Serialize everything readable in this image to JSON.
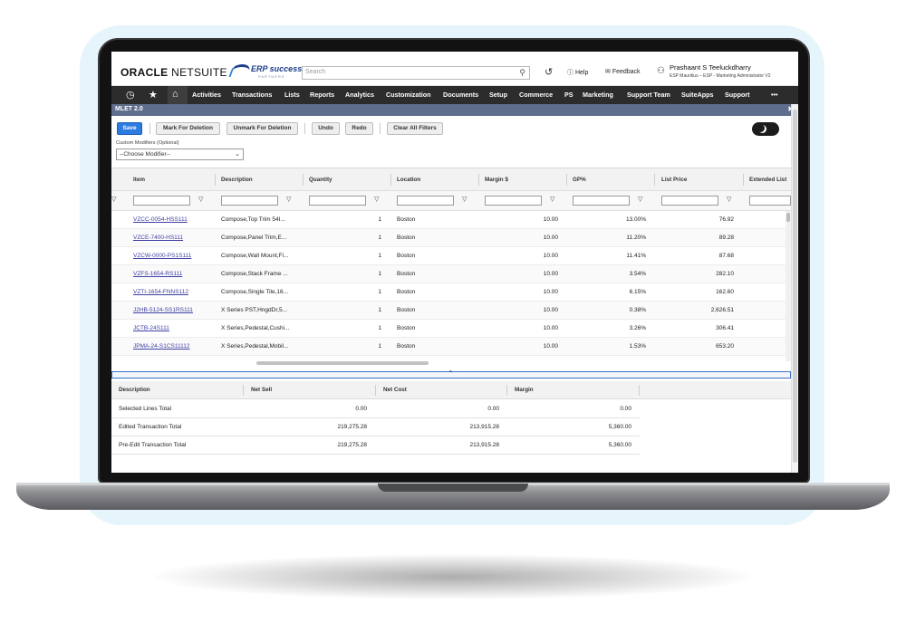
{
  "header": {
    "brand_bold": "ORACLE",
    "brand_light": " NETSUITE",
    "partner_name": "ERP success",
    "partner_sub": "PARTNERS",
    "search_placeholder": "Search",
    "help": "Help",
    "feedback": "Feedback",
    "user_name": "Prashaant S Teeluckdharry",
    "user_role": "ESP Mauritius – ESP - Marketing Administrator V2"
  },
  "nav": {
    "items": [
      "Activities",
      "Transactions",
      "Lists",
      "Reports",
      "Analytics",
      "Customization",
      "Documents",
      "Setup",
      "Commerce",
      "PS",
      "Marketing",
      "Support Team",
      "SuiteApps",
      "Support"
    ],
    "more": "•••",
    "icons": [
      "recent-icon",
      "star-icon",
      "home-icon"
    ]
  },
  "module": {
    "title": "MLET 2.0",
    "close": "✖"
  },
  "toolbar": {
    "save": "Save",
    "mark_deletion": "Mark For Deletion",
    "unmark_deletion": "Unmark For Deletion",
    "undo": "Undo",
    "redo": "Redo",
    "clear_filters": "Clear All Filters"
  },
  "custom_modifiers": {
    "label": "Custom Modifiers (Optional)",
    "selected": "--Choose Modifier--"
  },
  "grid": {
    "columns": [
      "Item",
      "Description",
      "Quantity",
      "Location",
      "Margin $",
      "GP%",
      "List Price",
      "Extended List"
    ],
    "rows": [
      {
        "item": "VZCC-0054-HSS111",
        "description": "Compose,Top Trim 54I...",
        "quantity": "1",
        "location": "Boston",
        "margin": "10.00",
        "gp": "13.00%",
        "list_price": "76.92"
      },
      {
        "item": "VZCE-7400-HS111",
        "description": "Compose,Panel Trim,E...",
        "quantity": "1",
        "location": "Boston",
        "margin": "10.00",
        "gp": "11.20%",
        "list_price": "89.28"
      },
      {
        "item": "VZCW-0000-PS1S111",
        "description": "Compose,Wall Mount,Fi...",
        "quantity": "1",
        "location": "Boston",
        "margin": "10.00",
        "gp": "11.41%",
        "list_price": "87.68"
      },
      {
        "item": "VZFS-1654-RS111",
        "description": "Compose,Stack Frame ...",
        "quantity": "1",
        "location": "Boston",
        "margin": "10.00",
        "gp": "3.54%",
        "list_price": "282.10"
      },
      {
        "item": "VZTI-1654-FNNS112",
        "description": "Compose,Single Tile,16...",
        "quantity": "1",
        "location": "Boston",
        "margin": "10.00",
        "gp": "6.15%",
        "list_price": "162.60"
      },
      {
        "item": "J2HB-5124-SS1RS111",
        "description": "X Series PST,HngdDr,5...",
        "quantity": "1",
        "location": "Boston",
        "margin": "10.00",
        "gp": "0.38%",
        "list_price": "2,626.51"
      },
      {
        "item": "JCTB-24S111",
        "description": "X Series,Pedestal,Cushi...",
        "quantity": "1",
        "location": "Boston",
        "margin": "10.00",
        "gp": "3.26%",
        "list_price": "306.41"
      },
      {
        "item": "JPMA-24-S1CS11112",
        "description": "X Series,Pedestal,Mobil...",
        "quantity": "1",
        "location": "Boston",
        "margin": "10.00",
        "gp": "1.53%",
        "list_price": "653.20"
      }
    ]
  },
  "summary": {
    "columns": [
      "Description",
      "Net Sell",
      "Net Cost",
      "Margin"
    ],
    "rows": [
      {
        "description": "Selected Lines Total",
        "net_sell": "0.00",
        "net_cost": "0.00",
        "margin": "0.00"
      },
      {
        "description": "Edited Transaction Total",
        "net_sell": "219,275.28",
        "net_cost": "213,915.28",
        "margin": "5,360.00"
      },
      {
        "description": "Pre-Edit Transaction Total",
        "net_sell": "219,275.28",
        "net_cost": "213,915.28",
        "margin": "5,360.00"
      }
    ]
  },
  "colors": {
    "accent": "#2c7be0",
    "nav_bg": "#2c2c2c",
    "module_bar": "#5f6e8d",
    "link": "#3f3fa3"
  }
}
